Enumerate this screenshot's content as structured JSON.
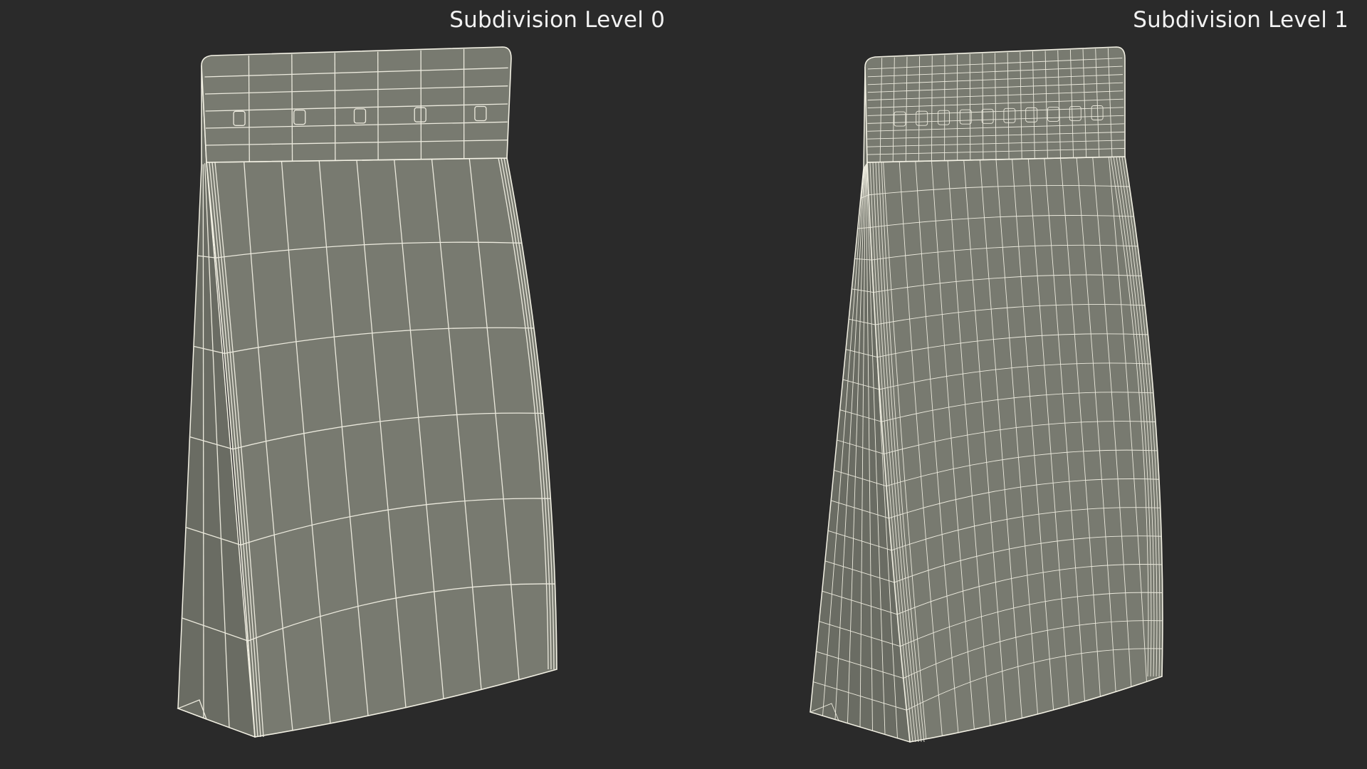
{
  "labels": {
    "level_0": "Subdivision Level 0",
    "level_1": "Subdivision Level 1"
  },
  "colors": {
    "background": "#2a2a2a",
    "surface": "#787a70",
    "surface_dark": "#6a6c63",
    "wire": "#f3f1e4"
  }
}
